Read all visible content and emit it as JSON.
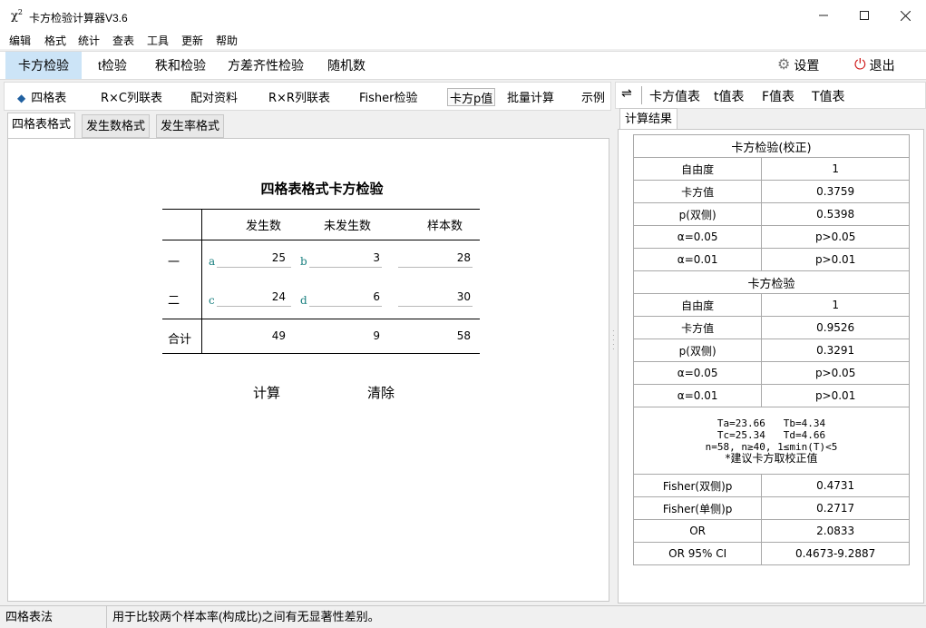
{
  "window": {
    "app_icon": "χ²",
    "title": "卡方检验计算器V3.6",
    "min_icon": "minimize-icon",
    "max_icon": "maximize-icon",
    "close_icon": "close-icon"
  },
  "menu": [
    "编辑",
    "格式",
    "统计",
    "查表",
    "工具",
    "更新",
    "帮助"
  ],
  "toolbar": {
    "items": [
      "卡方检验",
      "t检验",
      "秩和检验",
      "方差齐性检验",
      "随机数"
    ],
    "active": "卡方检验",
    "settings_label": "设置",
    "exit_label": "退出",
    "accent": "#cce4f7",
    "exit_color": "#d02020"
  },
  "subnav": {
    "items": [
      "四格表",
      "R×C列联表",
      "配对资料",
      "R×R列联表",
      "Fisher检验",
      "卡方p值",
      "批量计算",
      "示例"
    ]
  },
  "format_tabs": [
    "四格表格式",
    "发生数格式",
    "发生率格式"
  ],
  "fourfold": {
    "heading": "四格表格式卡方检验",
    "headers": [
      "发生数",
      "未发生数",
      "样本数"
    ],
    "rows": [
      {
        "label": "一",
        "cells": [
          {
            "letter": "a",
            "value": "25"
          },
          {
            "letter": "b",
            "value": "3"
          }
        ],
        "total": "28"
      },
      {
        "label": "二",
        "cells": [
          {
            "letter": "c",
            "value": "24"
          },
          {
            "letter": "d",
            "value": "6"
          }
        ],
        "total": "30"
      }
    ],
    "sum_label": "合计",
    "sums": [
      "49",
      "9",
      "58"
    ],
    "compute_label": "计算",
    "clear_label": "清除"
  },
  "right": {
    "tools": [
      "卡方值表",
      "t值表",
      "F值表",
      "T值表"
    ],
    "swap_icon": "swap-arrows-icon",
    "tab": "计算结果",
    "section1": "卡方检验(校正)",
    "rows1": [
      [
        "自由度",
        "1"
      ],
      [
        "卡方值",
        "0.3759"
      ],
      [
        "p(双侧)",
        "0.5398"
      ],
      [
        "α=0.05",
        "p>0.05"
      ],
      [
        "α=0.01",
        "p>0.01"
      ]
    ],
    "section2": "卡方检验",
    "rows2": [
      [
        "自由度",
        "1"
      ],
      [
        "卡方值",
        "0.9526"
      ],
      [
        "p(双侧)",
        "0.3291"
      ],
      [
        "α=0.05",
        "p>0.05"
      ],
      [
        "α=0.01",
        "p>0.01"
      ]
    ],
    "note": [
      "Ta=23.66   Tb=4.34",
      "Tc=25.34   Td=4.66",
      "n=58, n≥40, 1≤min(T)<5",
      "*建议卡方取校正值"
    ],
    "rows3": [
      [
        "Fisher(双侧)p",
        "0.4731"
      ],
      [
        "Fisher(单侧)p",
        "0.2717"
      ],
      [
        "OR",
        "2.0833"
      ],
      [
        "OR 95% CI",
        "0.4673-9.2887"
      ]
    ]
  },
  "status": {
    "left": "四格表法",
    "message": "用于比较两个样本率(构成比)之间有无显著性差别。"
  }
}
